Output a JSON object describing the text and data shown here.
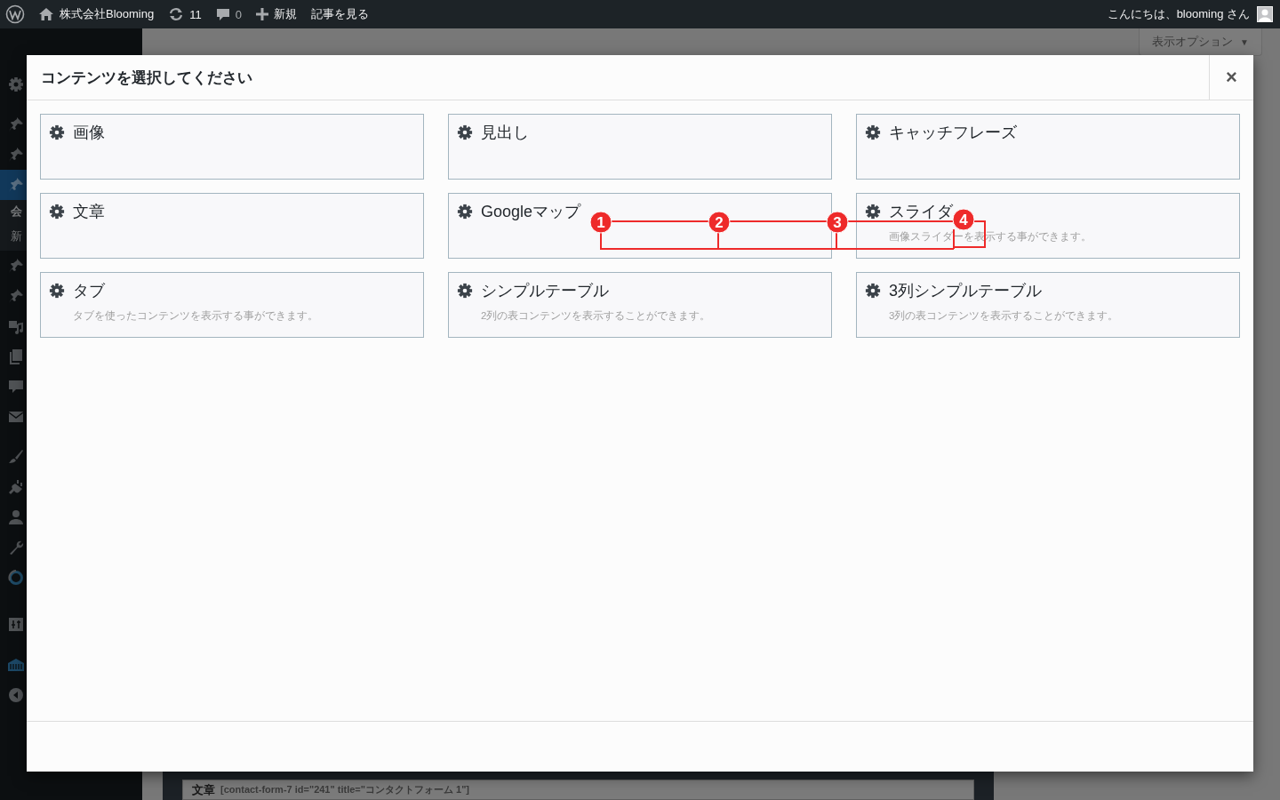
{
  "admin_bar": {
    "items": [
      {
        "kind": "logo"
      },
      {
        "kind": "site",
        "label": "株式会社Blooming"
      },
      {
        "kind": "updates",
        "label": "11"
      },
      {
        "kind": "comments",
        "label": "0"
      },
      {
        "kind": "new",
        "label": "新規"
      },
      {
        "kind": "view",
        "label": "記事を見る"
      }
    ],
    "greeting": "こんにちは、blooming さん"
  },
  "sidebar": {
    "items": [
      {
        "selected": false
      },
      {
        "selected": false
      },
      {
        "selected": false
      },
      {
        "selected": true,
        "submenu": [
          "会",
          "新"
        ]
      },
      {
        "selected": false
      },
      {
        "selected": false
      },
      {
        "selected": false
      },
      {
        "selected": false
      },
      {
        "selected": false
      },
      {
        "selected": false
      },
      {
        "selected": false
      },
      {
        "selected": false
      },
      {
        "selected": false
      },
      {
        "selected": false
      },
      {
        "selected": false
      },
      {
        "selected": false
      },
      {
        "selected": false
      },
      {
        "selected": false
      }
    ]
  },
  "screen_options": {
    "label": "表示オプション",
    "caret": "▼"
  },
  "modal": {
    "title": "コンテンツを選択してください",
    "close": "×",
    "items": [
      {
        "title": "画像"
      },
      {
        "title": "見出し"
      },
      {
        "title": "キャッチフレーズ"
      },
      {
        "title": "文章"
      },
      {
        "title": "Googleマップ"
      },
      {
        "title": "スライダ",
        "description": "画像スライダーを表示する事ができます。"
      },
      {
        "title": "タブ",
        "description": "タブを使ったコンテンツを表示する事ができます。"
      },
      {
        "title": "シンプルテーブル",
        "description": "2列の表コンテンツを表示することができます。"
      },
      {
        "title": "3列シンプルテーブル",
        "description": "3列の表コンテンツを表示することができます。"
      }
    ]
  },
  "background_row": {
    "label": "文章",
    "shortcode": "[contact-form-7 id=\"241\" title=\"コンタクトフォーム 1\"]"
  },
  "annotations": [
    {
      "number": "1"
    },
    {
      "number": "2"
    },
    {
      "number": "3"
    },
    {
      "number": "4"
    }
  ]
}
